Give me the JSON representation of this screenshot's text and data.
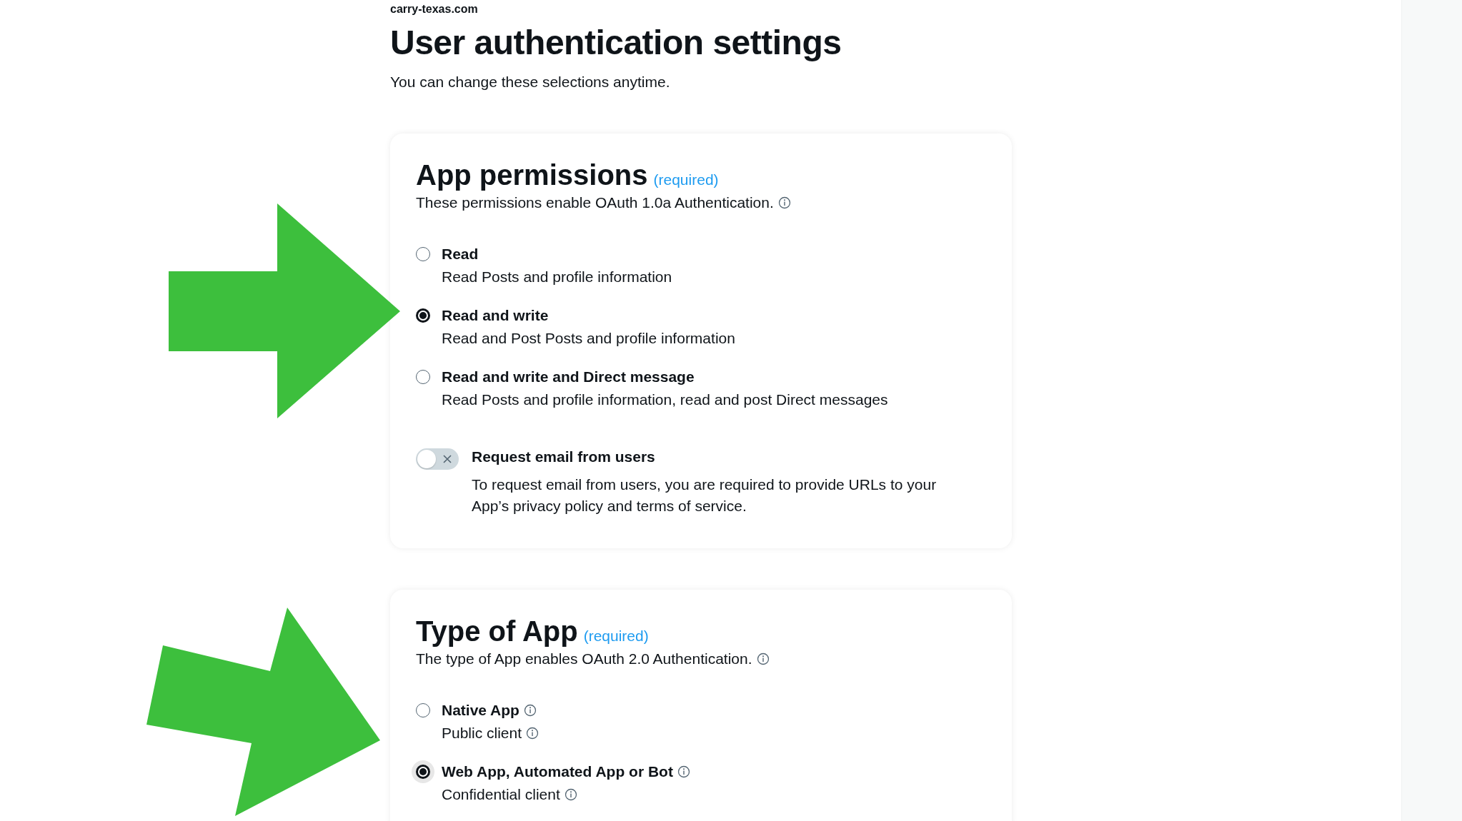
{
  "site": "carry-texas.com",
  "page": {
    "title": "User authentication settings",
    "subtitle": "You can change these selections anytime."
  },
  "sections": [
    {
      "title": "App permissions",
      "required": "(required)",
      "description": "These permissions enable OAuth 1.0a Authentication.",
      "description_info": true,
      "options": [
        {
          "label": "Read",
          "label_info": false,
          "sublabel": "Read Posts and profile information",
          "sublabel_info": false,
          "selected": false,
          "focused": false
        },
        {
          "label": "Read and write",
          "label_info": false,
          "sublabel": "Read and Post Posts and profile information",
          "sublabel_info": false,
          "selected": true,
          "focused": false
        },
        {
          "label": "Read and write and Direct message",
          "label_info": false,
          "sublabel": "Read Posts and profile information, read and post Direct messages",
          "sublabel_info": false,
          "selected": false,
          "focused": false
        }
      ],
      "toggle": {
        "label": "Request email from users",
        "text": "To request email from users, you are required to provide URLs to your App’s privacy policy and terms of service.",
        "on": false
      }
    },
    {
      "title": "Type of App",
      "required": "(required)",
      "description": "The type of App enables OAuth 2.0 Authentication.",
      "description_info": true,
      "options": [
        {
          "label": "Native App",
          "label_info": true,
          "sublabel": "Public client",
          "sublabel_info": true,
          "selected": false,
          "focused": false
        },
        {
          "label": "Web App, Automated App or Bot",
          "label_info": true,
          "sublabel": "Confidential client",
          "sublabel_info": true,
          "selected": true,
          "focused": true
        }
      ]
    }
  ]
}
